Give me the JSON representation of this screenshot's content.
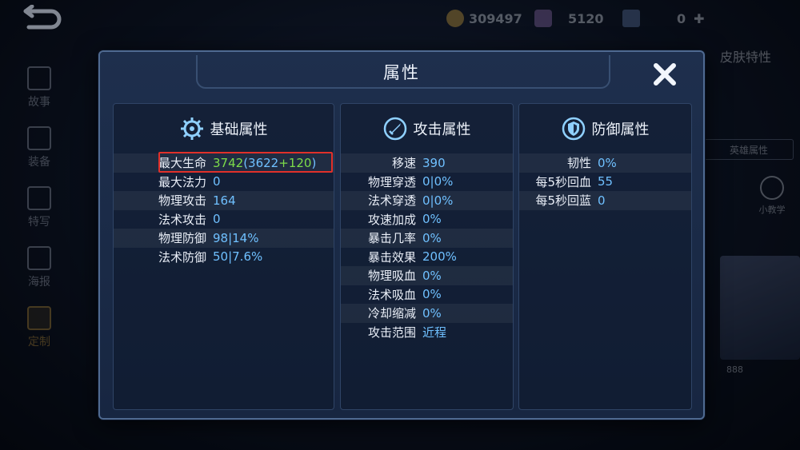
{
  "hud": {
    "gold": "309497",
    "gems": "5120",
    "tickets": "0",
    "add_symbol": "✚"
  },
  "sidebar": {
    "items": [
      {
        "label": "故事"
      },
      {
        "label": "装备"
      },
      {
        "label": "特写"
      },
      {
        "label": "海报"
      },
      {
        "label": "定制"
      }
    ]
  },
  "right_panel": {
    "skin_title": "皮肤特性",
    "hero_attr_button": "英雄属性",
    "tutorial_label": "小教学",
    "card_count": "888"
  },
  "modal": {
    "title": "属性",
    "columns": [
      {
        "title": "基础属性",
        "icon": "gear-icon",
        "rows": [
          {
            "key": "最大生命",
            "value": "3742",
            "detail_open": "(",
            "base": "3622",
            "plus": "+120",
            "detail_close": ")"
          },
          {
            "key": "最大法力",
            "value": "0"
          },
          {
            "key": "物理攻击",
            "value": "164"
          },
          {
            "key": "法术攻击",
            "value": "0"
          },
          {
            "key": "物理防御",
            "value": "98|14%"
          },
          {
            "key": "法术防御",
            "value": "50|7.6%"
          }
        ]
      },
      {
        "title": "攻击属性",
        "icon": "sword-icon",
        "rows": [
          {
            "key": "移速",
            "value": "390"
          },
          {
            "key": "物理穿透",
            "value": "0|0%"
          },
          {
            "key": "法术穿透",
            "value": "0|0%"
          },
          {
            "key": "攻速加成",
            "value": "0%"
          },
          {
            "key": "暴击几率",
            "value": "0%"
          },
          {
            "key": "暴击效果",
            "value": "200%"
          },
          {
            "key": "物理吸血",
            "value": "0%"
          },
          {
            "key": "法术吸血",
            "value": "0%"
          },
          {
            "key": "冷却缩减",
            "value": "0%"
          },
          {
            "key": "攻击范围",
            "value": "近程"
          }
        ]
      },
      {
        "title": "防御属性",
        "icon": "shield-icon",
        "rows": [
          {
            "key": "韧性",
            "value": "0%"
          },
          {
            "key": "每5秒回血",
            "value": "55"
          },
          {
            "key": "每5秒回蓝",
            "value": "0"
          }
        ]
      }
    ]
  },
  "colors": {
    "value_blue": "#6fc0ff",
    "bonus_green": "#7ddc4a",
    "highlight_red": "#e0302a"
  }
}
